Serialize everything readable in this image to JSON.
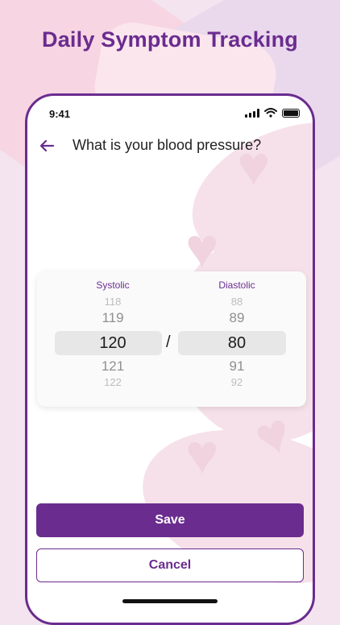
{
  "headline": "Daily Symptom Tracking",
  "status_bar": {
    "time": "9:41"
  },
  "nav": {
    "title": "What is your blood pressure?"
  },
  "picker": {
    "systolic_label": "Systolic",
    "diastolic_label": "Diastolic",
    "systolic_values": {
      "far_above": "118",
      "above": "119",
      "selected": "120",
      "below": "121",
      "far_below": "122"
    },
    "diastolic_values": {
      "far_above": "88",
      "above": "89",
      "selected": "80",
      "below": "91",
      "far_below": "92"
    },
    "separator": "/"
  },
  "actions": {
    "save_label": "Save",
    "cancel_label": "Cancel"
  },
  "colors": {
    "accent": "#6a2c8f",
    "selection_bg": "#e7e7e7",
    "decor_pink": "#f6e1ea"
  },
  "icons": [
    "back-arrow-icon",
    "signal-icon",
    "wifi-icon",
    "battery-icon",
    "heart-icon"
  ]
}
